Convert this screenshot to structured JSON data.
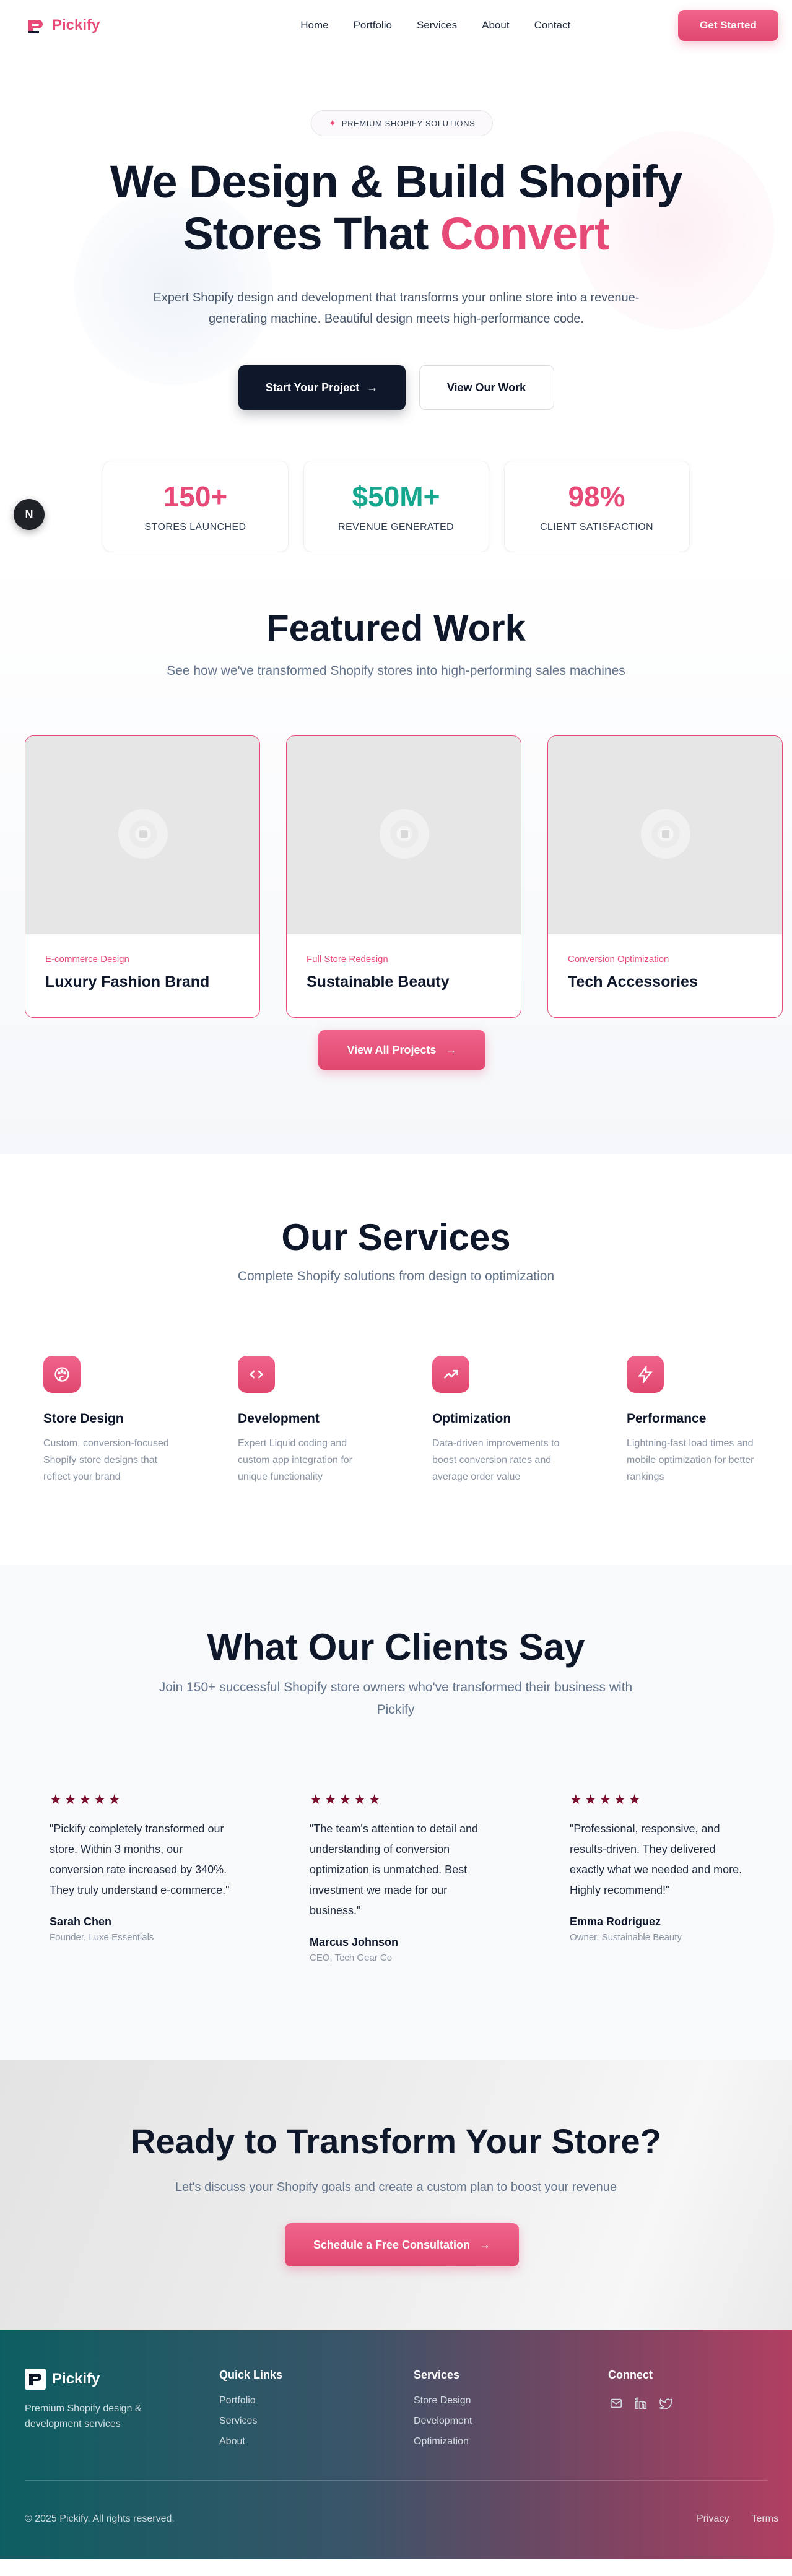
{
  "brand": {
    "name": "Pickify",
    "accent": "#e84a78",
    "dark": "#0f172a"
  },
  "nav": {
    "links": [
      "Home",
      "Portfolio",
      "Services",
      "About",
      "Contact"
    ],
    "cta": "Get Started"
  },
  "hero": {
    "badge": "PREMIUM SHOPIFY SOLUTIONS",
    "title_line1": "We Design & Build Shopify",
    "title_line2": "Stores That ",
    "title_accent": "Convert",
    "subtitle": "Expert Shopify design and development that transforms your online store into a revenue-generating machine. Beautiful design meets high-performance code.",
    "primary_cta": "Start Your Project",
    "secondary_cta": "View Our Work",
    "stats": [
      {
        "value": "150+",
        "label": "STORES LAUNCHED",
        "color": "#e84a78"
      },
      {
        "value": "$50M+",
        "label": "REVENUE GENERATED",
        "color": "#17a78f"
      },
      {
        "value": "98%",
        "label": "CLIENT SATISFACTION",
        "color": "#e84a78"
      }
    ],
    "floating_badge": "N"
  },
  "featured": {
    "title": "Featured Work",
    "subtitle": "See how we've transformed Shopify stores into high-performing sales machines",
    "projects": [
      {
        "tag": "E-commerce Design",
        "name": "Luxury Fashion Brand"
      },
      {
        "tag": "Full Store Redesign",
        "name": "Sustainable Beauty"
      },
      {
        "tag": "Conversion Optimization",
        "name": "Tech Accessories"
      }
    ],
    "cta": "View All Projects"
  },
  "services": {
    "title": "Our Services",
    "subtitle": "Complete Shopify solutions from design to optimization",
    "items": [
      {
        "icon": "palette-icon",
        "title": "Store Design",
        "desc": "Custom, conversion-focused Shopify store designs that reflect your brand"
      },
      {
        "icon": "code-icon",
        "title": "Development",
        "desc": "Expert Liquid coding and custom app integration for unique functionality"
      },
      {
        "icon": "trending-up-icon",
        "title": "Optimization",
        "desc": "Data-driven improvements to boost conversion rates and average order value"
      },
      {
        "icon": "zap-icon",
        "title": "Performance",
        "desc": "Lightning-fast load times and mobile optimization for better rankings"
      }
    ]
  },
  "testimonials": {
    "title": "What Our Clients Say",
    "subtitle": "Join 150+ successful Shopify store owners who've transformed their business with Pickify",
    "stars": "★★★★★",
    "items": [
      {
        "quote": "\"Pickify completely transformed our store. Within 3 months, our conversion rate increased by 340%. They truly understand e-commerce.\"",
        "name": "Sarah Chen",
        "role": "Founder, Luxe Essentials"
      },
      {
        "quote": "\"The team's attention to detail and understanding of conversion optimization is unmatched. Best investment we made for our business.\"",
        "name": "Marcus Johnson",
        "role": "CEO, Tech Gear Co"
      },
      {
        "quote": "\"Professional, responsive, and results-driven. They delivered exactly what we needed and more. Highly recommend!\"",
        "name": "Emma Rodriguez",
        "role": "Owner, Sustainable Beauty"
      }
    ]
  },
  "cta": {
    "title": "Ready to Transform Your Store?",
    "subtitle": "Let's discuss your Shopify goals and create a custom plan to boost your revenue",
    "button": "Schedule a Free Consultation"
  },
  "footer": {
    "brand": "Pickify",
    "tagline": "Premium Shopify design & development services",
    "quick_links_title": "Quick Links",
    "quick_links": [
      "Portfolio",
      "Services",
      "About"
    ],
    "services_title": "Services",
    "services": [
      "Store Design",
      "Development",
      "Optimization"
    ],
    "connect_title": "Connect",
    "socials": [
      "mail-icon",
      "linkedin-icon",
      "twitter-icon"
    ],
    "copyright": "© 2025 Pickify. All rights reserved.",
    "legal": [
      "Privacy",
      "Terms"
    ]
  }
}
